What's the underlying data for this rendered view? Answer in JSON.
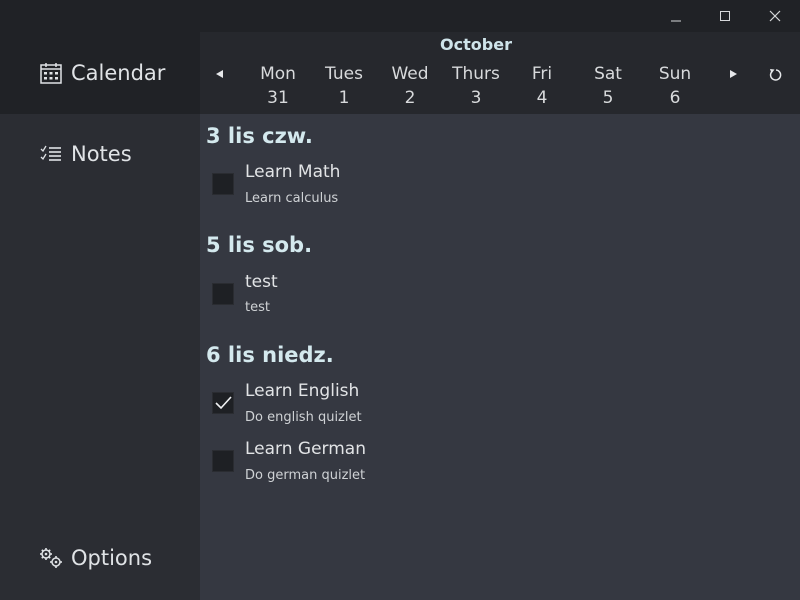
{
  "window_controls": {
    "minimize_icon": "minimize-icon",
    "maximize_icon": "maximize-icon",
    "close_icon": "close-icon"
  },
  "sidebar": {
    "items": [
      {
        "label": "Calendar",
        "icon": "calendar-icon",
        "active": true
      },
      {
        "label": "Notes",
        "icon": "checklist-icon",
        "active": false
      },
      {
        "label": "Options",
        "icon": "gears-icon",
        "active": false
      }
    ]
  },
  "calendar": {
    "month": "October",
    "days": [
      {
        "name": "Mon",
        "num": "31"
      },
      {
        "name": "Tues",
        "num": "1"
      },
      {
        "name": "Wed",
        "num": "2"
      },
      {
        "name": "Thurs",
        "num": "3"
      },
      {
        "name": "Fri",
        "num": "4"
      },
      {
        "name": "Sat",
        "num": "5"
      },
      {
        "name": "Sun",
        "num": "6"
      }
    ]
  },
  "groups": [
    {
      "title": "3 lis czw.",
      "tasks": [
        {
          "title": "Learn Math",
          "desc": "Learn calculus",
          "checked": false
        }
      ]
    },
    {
      "title": "5 lis sob.",
      "tasks": [
        {
          "title": "test",
          "desc": "test",
          "checked": false
        }
      ]
    },
    {
      "title": "6 lis niedz.",
      "tasks": [
        {
          "title": "Learn English",
          "desc": "Do english quizlet",
          "checked": true
        },
        {
          "title": "Learn German",
          "desc": "Do german quizlet",
          "checked": false
        }
      ]
    }
  ],
  "colors": {
    "background": "#353841",
    "sidebar": "#2b2d33",
    "titlebar": "#202226",
    "accent_text": "#d4e9ee"
  }
}
